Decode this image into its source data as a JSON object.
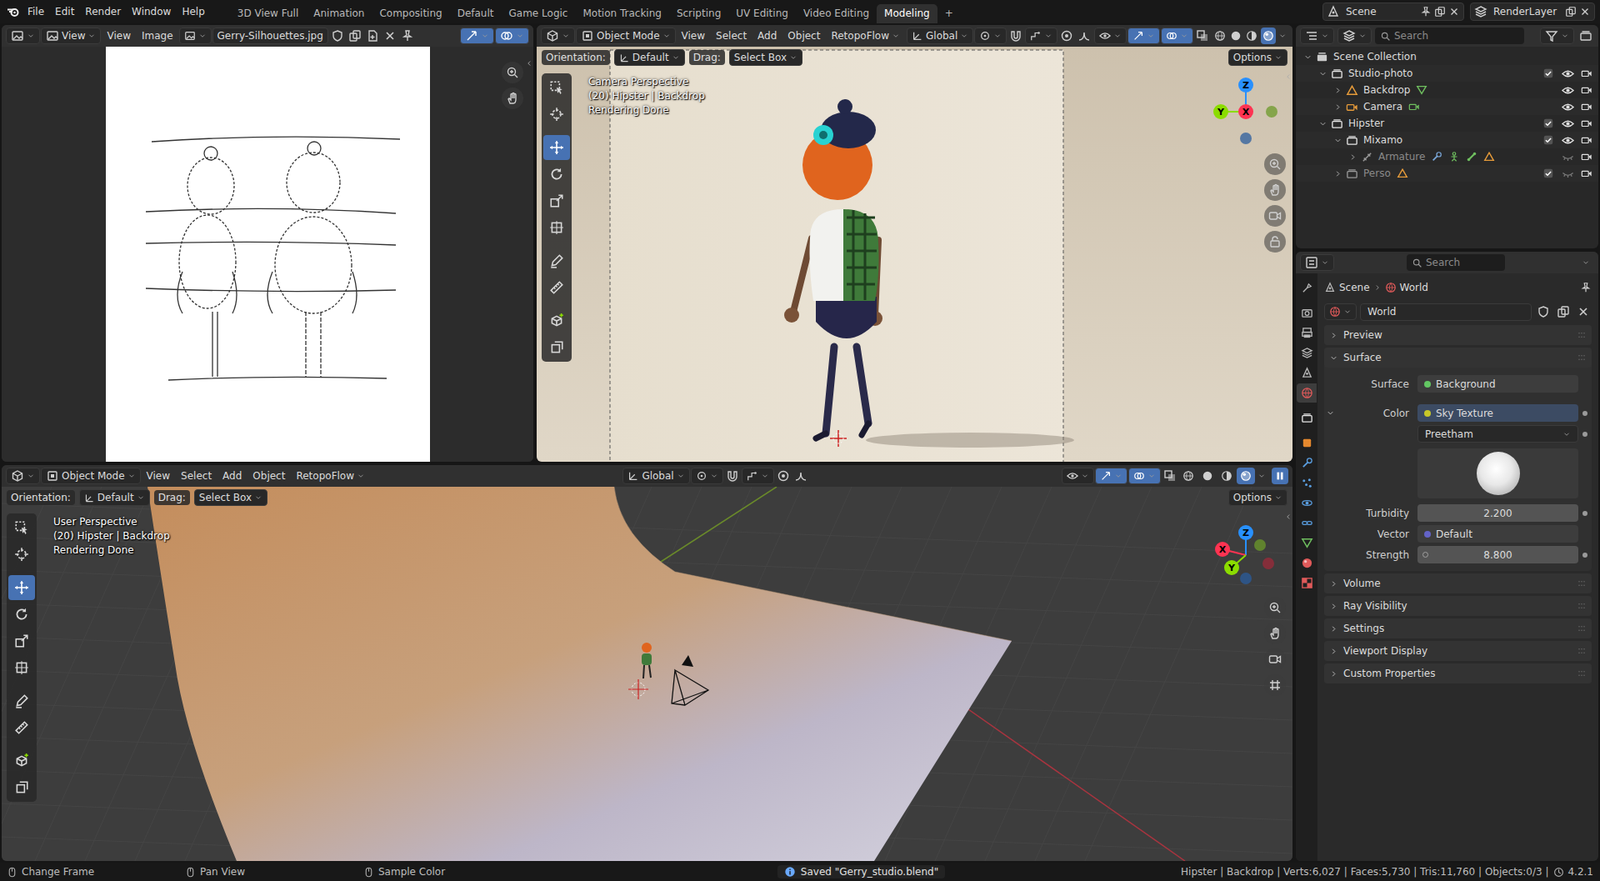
{
  "topbar": {
    "menus": [
      "File",
      "Edit",
      "Render",
      "Window",
      "Help"
    ],
    "workspaces": [
      {
        "label": "3D View Full",
        "selected": false
      },
      {
        "label": "Animation",
        "selected": false
      },
      {
        "label": "Compositing",
        "selected": false
      },
      {
        "label": "Default",
        "selected": false
      },
      {
        "label": "Game Logic",
        "selected": false
      },
      {
        "label": "Motion Tracking",
        "selected": false
      },
      {
        "label": "Scripting",
        "selected": false
      },
      {
        "label": "UV Editing",
        "selected": false
      },
      {
        "label": "Video Editing",
        "selected": false
      },
      {
        "label": "Modeling",
        "selected": true
      }
    ],
    "add_workspace": "+",
    "scene": "Scene",
    "view_layer": "RenderLayer"
  },
  "image_editor": {
    "view_mode": "View",
    "menus": [
      "View",
      "Image"
    ],
    "image_name": "Gerry-Silhouettes.jpg",
    "gizmos": true,
    "overlays": true
  },
  "viewport_top": {
    "mode": "Object Mode",
    "menus": [
      "View",
      "Select",
      "Add",
      "Object",
      "RetopoFlow"
    ],
    "transform": "Global",
    "orientation_label": "Orientation:",
    "orientation": "Default",
    "drag_label": "Drag:",
    "drag": "Select Box",
    "options": "Options",
    "overlay": [
      "Camera Perspective",
      "(20) Hipster | Backdrop",
      "Rendering Done"
    ],
    "gizmos": true,
    "overlays": true,
    "tools": [
      {
        "kind": "select",
        "selected": false
      },
      {
        "kind": "cursor",
        "selected": false
      },
      {
        "kind": "move",
        "selected": true
      },
      {
        "kind": "rotate",
        "selected": false
      },
      {
        "kind": "scale",
        "selected": false
      },
      {
        "kind": "transform",
        "selected": false
      },
      {
        "kind": "annotate",
        "selected": false
      },
      {
        "kind": "measure",
        "selected": false
      },
      {
        "kind": "addcube",
        "selected": false
      },
      {
        "kind": "addprim",
        "selected": false
      }
    ],
    "shading": [
      {
        "kind": "wire",
        "selected": false
      },
      {
        "kind": "solid",
        "selected": false
      },
      {
        "kind": "material",
        "selected": false
      },
      {
        "kind": "rendered",
        "selected": true
      }
    ],
    "gizmo": {
      "x": "X",
      "y": "Y",
      "z": "Z"
    }
  },
  "viewport_bottom": {
    "mode": "Object Mode",
    "menus": [
      "View",
      "Select",
      "Add",
      "Object",
      "RetopoFlow"
    ],
    "transform": "Global",
    "orientation_label": "Orientation:",
    "orientation": "Default",
    "drag_label": "Drag:",
    "drag": "Select Box",
    "options": "Options",
    "overlay": [
      "User Perspective",
      "(20) Hipster | Backdrop",
      "Rendering Done"
    ],
    "gizmos": true,
    "overlays": true,
    "pause_active": true,
    "tools": [
      {
        "kind": "select",
        "selected": false
      },
      {
        "kind": "cursor",
        "selected": false
      },
      {
        "kind": "move",
        "selected": true
      },
      {
        "kind": "rotate",
        "selected": false
      },
      {
        "kind": "scale",
        "selected": false
      },
      {
        "kind": "transform",
        "selected": false
      },
      {
        "kind": "annotate",
        "selected": false
      },
      {
        "kind": "measure",
        "selected": false
      },
      {
        "kind": "addcube",
        "selected": false
      },
      {
        "kind": "addprim",
        "selected": false
      }
    ],
    "shading": [
      {
        "kind": "wire",
        "selected": false
      },
      {
        "kind": "solid",
        "selected": false
      },
      {
        "kind": "material",
        "selected": false
      },
      {
        "kind": "rendered",
        "selected": true
      }
    ],
    "gizmo": {
      "x": "X",
      "y": "Y",
      "z": "Z"
    }
  },
  "outliner": {
    "search_placeholder": "Search",
    "rows": [
      {
        "name": "Scene Collection",
        "kind": "scene",
        "depth": 0,
        "expanded": true,
        "dimmed": false,
        "extras": []
      },
      {
        "name": "Studio-photo",
        "kind": "collection",
        "depth": 1,
        "expanded": true,
        "dimmed": false,
        "extras": [],
        "checked": true,
        "visible": true,
        "renderable": true
      },
      {
        "name": "Backdrop",
        "kind": "mesh",
        "depth": 2,
        "expanded": false,
        "dimmed": false,
        "extras": [
          "meshdata"
        ],
        "visible": true,
        "renderable": true
      },
      {
        "name": "Camera",
        "kind": "camera",
        "depth": 2,
        "expanded": false,
        "dimmed": false,
        "extras": [
          "camdata"
        ],
        "visible": true,
        "renderable": true
      },
      {
        "name": "Hipster",
        "kind": "collection",
        "depth": 1,
        "expanded": true,
        "dimmed": false,
        "extras": [],
        "checked": true,
        "visible": true,
        "renderable": true
      },
      {
        "name": "Mixamo",
        "kind": "collection",
        "depth": 2,
        "expanded": true,
        "dimmed": false,
        "extras": [],
        "checked": true,
        "visible": true,
        "renderable": true
      },
      {
        "name": "Armature",
        "kind": "armature",
        "depth": 3,
        "expanded": false,
        "dimmed": true,
        "extras": [
          "modifier",
          "pose",
          "bone",
          "mesh"
        ],
        "visible": false,
        "renderable": true
      },
      {
        "name": "Perso",
        "kind": "collection",
        "depth": 2,
        "expanded": false,
        "dimmed": true,
        "extras": [
          "mesh"
        ],
        "checked": true,
        "visible": false,
        "renderable": true
      }
    ]
  },
  "properties": {
    "search_placeholder": "Search",
    "tabs": [
      {
        "kind": "tool",
        "selected": false
      },
      {
        "kind": "render",
        "selected": false
      },
      {
        "kind": "output",
        "selected": false
      },
      {
        "kind": "viewlayer",
        "selected": false
      },
      {
        "kind": "scene",
        "selected": false
      },
      {
        "kind": "world",
        "selected": true
      },
      {
        "kind": "collection",
        "selected": false
      },
      {
        "kind": "object",
        "selected": false
      },
      {
        "kind": "modifiers",
        "selected": false
      },
      {
        "kind": "particles",
        "selected": false
      },
      {
        "kind": "physics",
        "selected": false
      },
      {
        "kind": "constraints",
        "selected": false
      },
      {
        "kind": "data",
        "selected": false
      },
      {
        "kind": "material",
        "selected": false
      },
      {
        "kind": "texture",
        "selected": false
      }
    ],
    "breadcrumb": [
      "Scene",
      "World"
    ],
    "datablock": "World",
    "panels": [
      {
        "title": "Preview",
        "expanded": false
      },
      {
        "title": "Surface",
        "expanded": true,
        "fields": [
          {
            "kind": "link",
            "label": "Surface",
            "value": "Background",
            "color": "#63c763",
            "animatable": false
          },
          {
            "kind": "link",
            "label": "Color",
            "value": "Sky Texture",
            "color": "#c7c729",
            "expanded": true,
            "animatable": true
          },
          {
            "kind": "dropdown",
            "value": "Preetham",
            "animatable": true
          },
          {
            "kind": "preview",
            "animatable": false
          },
          {
            "kind": "number",
            "label": "Turbidity",
            "value": "2.200",
            "animatable": true
          },
          {
            "kind": "link",
            "label": "Vector",
            "value": "Default",
            "color": "#6363c7",
            "animatable": false
          },
          {
            "kind": "number",
            "label": "Strength",
            "value": "8.800",
            "color": "#a1a1a1",
            "animatable": true
          }
        ]
      },
      {
        "title": "Volume",
        "expanded": false
      },
      {
        "title": "Ray Visibility",
        "expanded": false
      },
      {
        "title": "Settings",
        "expanded": false
      },
      {
        "title": "Viewport Display",
        "expanded": false
      },
      {
        "title": "Custom Properties",
        "expanded": false
      }
    ]
  },
  "status_bar": {
    "hints": [
      "Change Frame",
      "Pan View",
      "Sample Color"
    ],
    "message": "Saved \"Gerry_studio.blend\"",
    "stats": "Hipster | Backdrop | Verts:6,027 | Faces:5,730 | Tris:11,760 | Objects:0/3 |",
    "version": "4.2.1"
  }
}
